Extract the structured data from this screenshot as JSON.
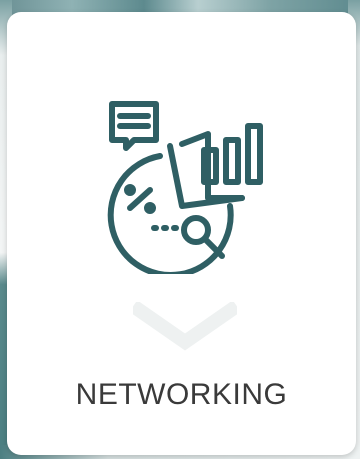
{
  "card": {
    "title": "NETWORKING",
    "icon": "analytics-chart-icon",
    "chevron_icon": "chevron-down-icon"
  },
  "colors": {
    "icon_stroke": "#2f5f64",
    "chevron": "#eef1f1",
    "title_text": "#3a3a3a",
    "card_background": "#ffffff"
  }
}
